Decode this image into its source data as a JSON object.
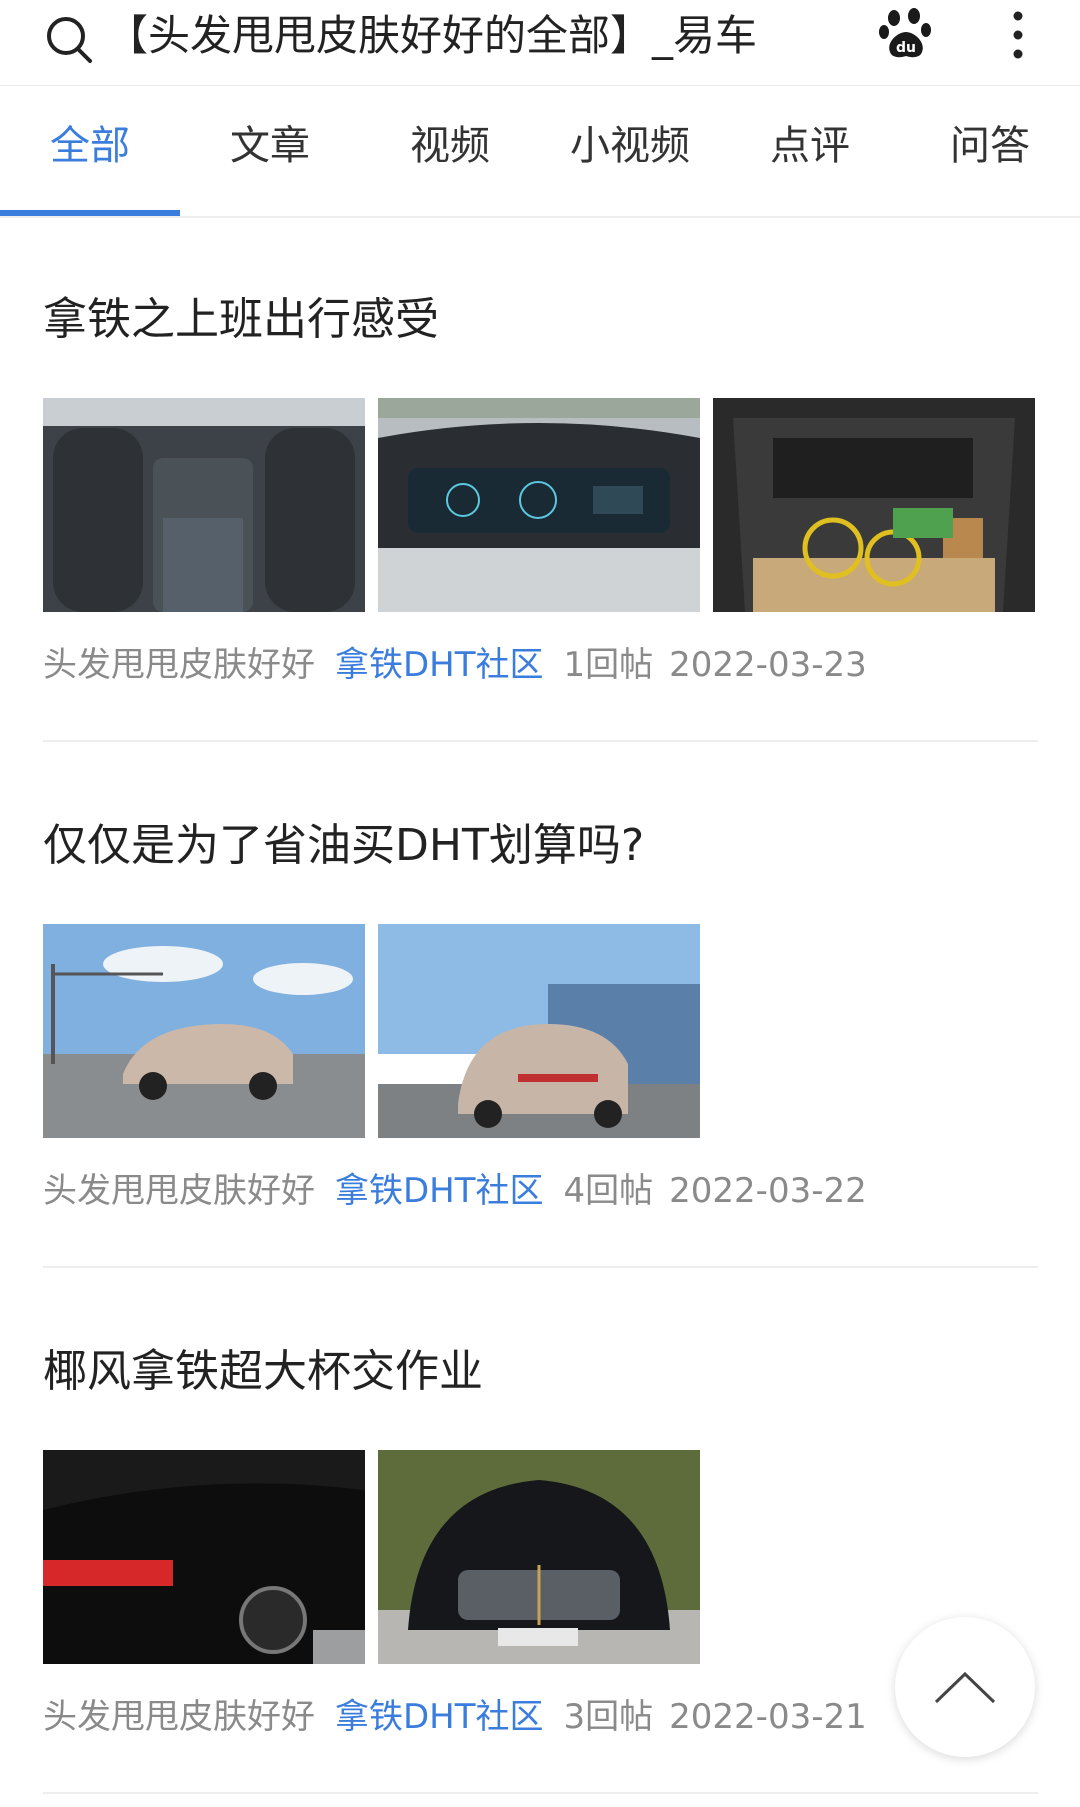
{
  "header": {
    "title": "【头发甩甩皮肤好好的全部】_易车",
    "search_icon": "search-icon",
    "baidu_icon": "baidu-paw-icon",
    "more_icon": "more-vertical-icon"
  },
  "tabs": [
    {
      "label": "全部",
      "active": true
    },
    {
      "label": "文章",
      "active": false
    },
    {
      "label": "视频",
      "active": false
    },
    {
      "label": "小视频",
      "active": false
    },
    {
      "label": "点评",
      "active": false
    },
    {
      "label": "问答",
      "active": false
    }
  ],
  "colors": {
    "accent": "#3b7ddd",
    "meta_text": "#8a8a8a",
    "divider": "#eeeeee"
  },
  "posts": [
    {
      "title": "拿铁之上班出行感受",
      "images": [
        "rear-seats-photo",
        "dashboard-screen-photo",
        "trunk-with-bicycle-photo"
      ],
      "author": "头发甩甩皮肤好好",
      "forum": "拿铁DHT社区",
      "replies": "1回帖",
      "date": "2022-03-23"
    },
    {
      "title": "仅仅是为了省油买DHT划算吗?",
      "images": [
        "suv-front-side-road-photo",
        "suv-rear-parking-photo"
      ],
      "author": "头发甩甩皮肤好好",
      "forum": "拿铁DHT社区",
      "replies": "4回帖",
      "date": "2022-03-22"
    },
    {
      "title": "椰风拿铁超大杯交作业",
      "images": [
        "black-suv-taillight-photo",
        "black-suv-front-grille-photo"
      ],
      "author": "头发甩甩皮肤好好",
      "forum": "拿铁DHT社区",
      "replies": "3回帖",
      "date": "2022-03-21"
    }
  ],
  "back_to_top_icon": "chevron-up-icon"
}
